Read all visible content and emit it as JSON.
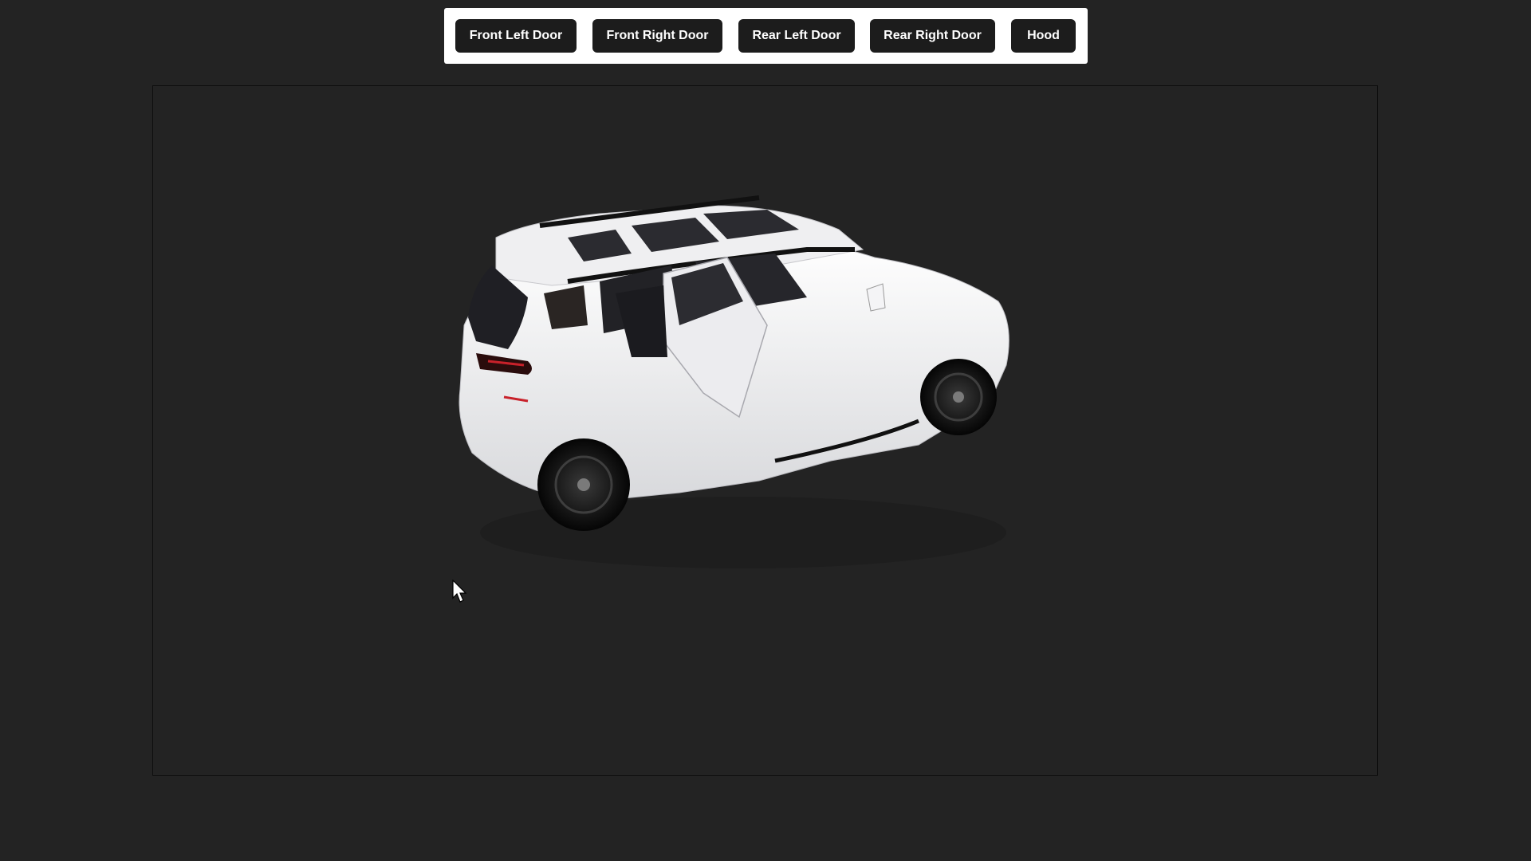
{
  "toolbar": {
    "buttons": [
      {
        "label": "Front Left Door"
      },
      {
        "label": "Front Right Door"
      },
      {
        "label": "Rear Left Door"
      },
      {
        "label": "Rear Right Door"
      },
      {
        "label": "Hood"
      }
    ]
  },
  "viewer": {
    "model_icon": "suv-3d-model",
    "car_color": "#f2f2f4"
  },
  "colors": {
    "background": "#232323",
    "button_bg": "#1c1c1c",
    "button_text": "#ffffff",
    "toolbar_bg": "#ffffff"
  }
}
